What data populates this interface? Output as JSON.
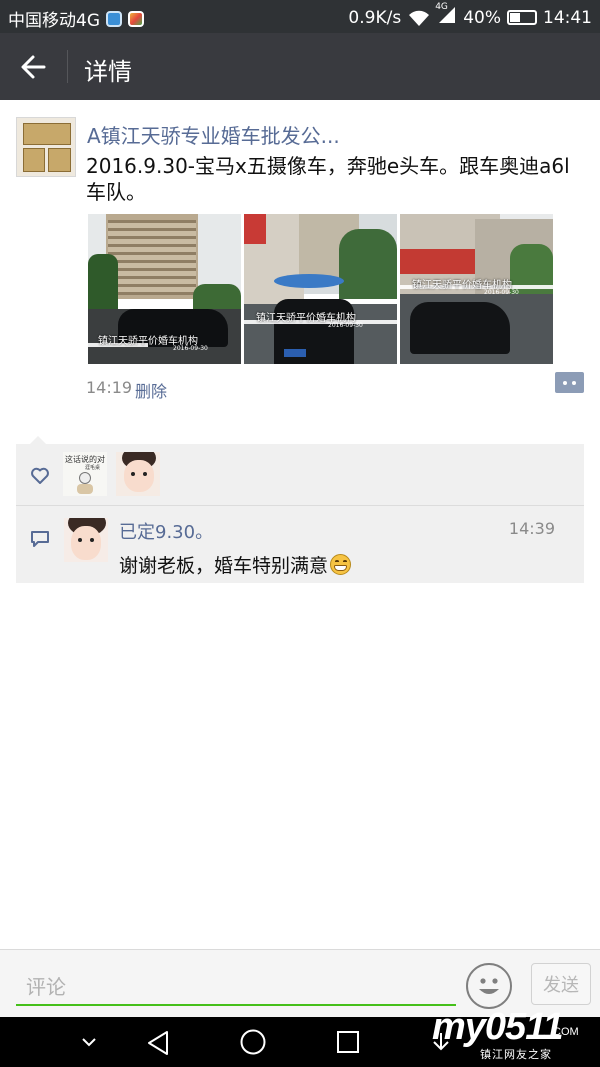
{
  "status_bar": {
    "carrier": "中国移动4G",
    "speed": "0.9K/s",
    "network": "4G",
    "battery": "40%",
    "battery_level": 0.4,
    "time": "14:41"
  },
  "title_bar": {
    "back_icon": "arrow-left-icon",
    "title": "详情"
  },
  "post": {
    "author": "A镇江天骄专业婚车批发公...",
    "text": "2016.9.30-宝马x五摄像车，奔驰e头车。跟车奥迪a6l车队。",
    "photos": [
      {
        "watermark": "镇江天骄平价婚车机构",
        "date": "2016-09-30"
      },
      {
        "watermark": "镇江天骄平价婚车机构",
        "date": "2016-09-30"
      },
      {
        "watermark": "镇江天骄平价婚车机构",
        "date": "2016-09-30"
      }
    ],
    "time": "14:19",
    "delete_label": "删除",
    "more_icon": "more-dots-icon"
  },
  "likes": {
    "icon": "heart-icon",
    "avatars": [
      {
        "caption": "这话说的对",
        "sub": "涯毛桌"
      },
      {
        "caption": ""
      }
    ]
  },
  "comments": [
    {
      "icon": "comment-icon",
      "name": "已定9.30。",
      "time": "14:39",
      "text": "谢谢老板，婚车特别满意",
      "emoji": "grin-emoji"
    }
  ],
  "input_bar": {
    "placeholder": "评论",
    "value": "",
    "emoji_icon": "emoji-smile-icon",
    "send_label": "发送"
  },
  "nav_bar": {
    "icons": [
      "chevron-down-icon",
      "back-triangle-icon",
      "home-circle-icon",
      "recent-square-icon",
      "download-icon"
    ]
  },
  "watermark": {
    "logo": "my0511",
    "domain": ".COM",
    "sub": "镇江网友之家"
  },
  "colors": {
    "title_bar": "#393a3f",
    "link": "#576b95",
    "accent_green": "#45c01a"
  }
}
